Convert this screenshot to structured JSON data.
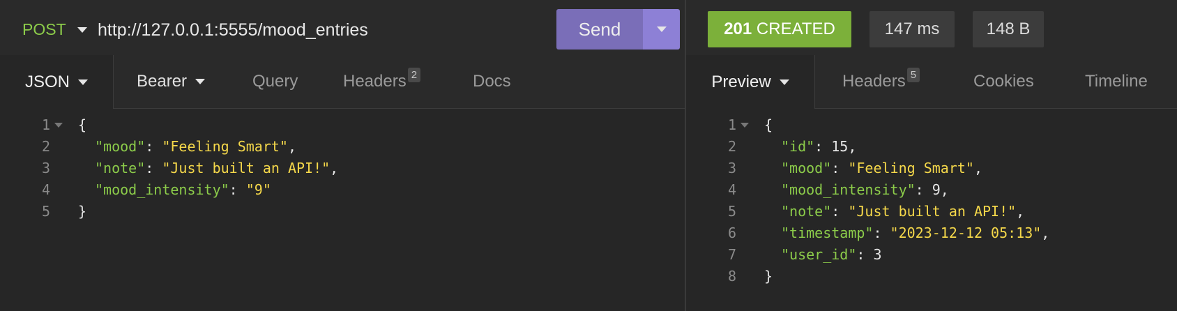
{
  "request": {
    "method": "POST",
    "url": "http://127.0.0.1:5555/mood_entries",
    "send_label": "Send",
    "tabs": [
      {
        "label": "JSON"
      },
      {
        "label": "Bearer"
      },
      {
        "label": "Query"
      },
      {
        "label": "Headers",
        "badge": "2"
      },
      {
        "label": "Docs"
      }
    ],
    "body_lines": [
      {
        "n": "1",
        "t": "{"
      },
      {
        "n": "2",
        "k": "\"mood\"",
        "v": "\"Feeling Smart\"",
        "e": ","
      },
      {
        "n": "3",
        "k": "\"note\"",
        "v": "\"Just built an API!\"",
        "e": ","
      },
      {
        "n": "4",
        "k": "\"mood_intensity\"",
        "v": "\"9\"",
        "e": ""
      },
      {
        "n": "5",
        "t": "}"
      }
    ]
  },
  "response": {
    "status_code": "201",
    "status_text": "CREATED",
    "time": "147 ms",
    "size": "148 B",
    "tabs": [
      {
        "label": "Preview"
      },
      {
        "label": "Headers",
        "badge": "5"
      },
      {
        "label": "Cookies"
      },
      {
        "label": "Timeline"
      }
    ],
    "body_lines": [
      {
        "n": "1",
        "t": "{"
      },
      {
        "n": "2",
        "k": "\"id\"",
        "num": "15",
        "e": ","
      },
      {
        "n": "3",
        "k": "\"mood\"",
        "v": "\"Feeling Smart\"",
        "e": ","
      },
      {
        "n": "4",
        "k": "\"mood_intensity\"",
        "num": "9",
        "e": ","
      },
      {
        "n": "5",
        "k": "\"note\"",
        "v": "\"Just built an API!\"",
        "e": ","
      },
      {
        "n": "6",
        "k": "\"timestamp\"",
        "v": "\"2023-12-12 05:13\"",
        "e": ","
      },
      {
        "n": "7",
        "k": "\"user_id\"",
        "num": "3",
        "e": ""
      },
      {
        "n": "8",
        "t": "}"
      }
    ]
  },
  "colors": {
    "method": "#8ccc4a",
    "json_key": "#8ccc4a",
    "json_string": "#f5d84a",
    "send": "#7a6eb8",
    "status_success": "#7cb03a"
  }
}
